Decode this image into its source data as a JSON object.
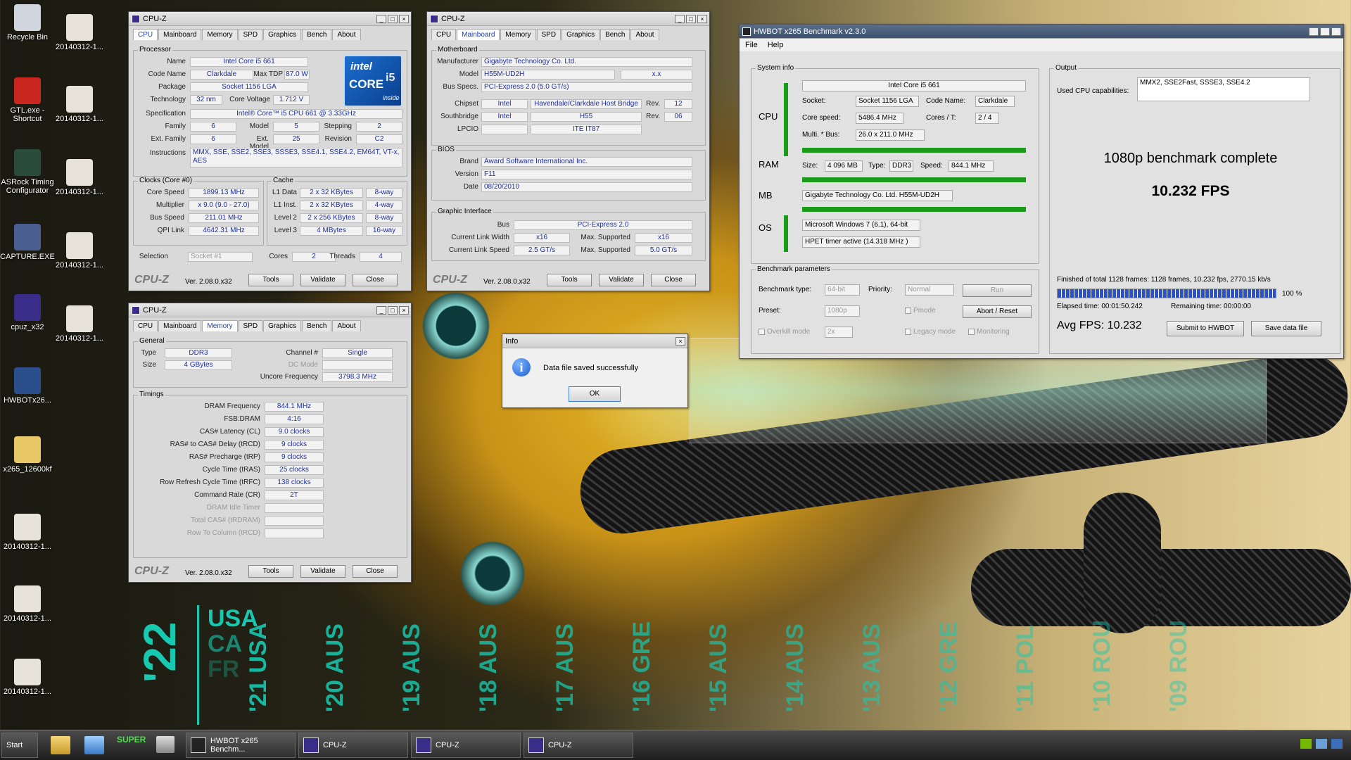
{
  "desktop": {
    "icons": [
      "Recycle Bin",
      "20140312-1...",
      "GTL.exe - Shortcut",
      "20140312-1...",
      "ASRock Timing Configurator",
      "20140312-1...",
      "CAPTURE.EXE",
      "20140312-1...",
      "cpuz_x32",
      "20140312-1...",
      "HWBOTx26...",
      "x265_12600kf",
      "20140312-1...",
      "20140312-1...",
      "20140312-1..."
    ],
    "wallpaper_text": {
      "year": "'22",
      "countries": [
        "USA",
        "CA",
        "FR"
      ],
      "timeline": [
        "'21 USA",
        "'20 AUS",
        "'19 AUS",
        "'18 AUS",
        "'17 AUS",
        "'16 GRE",
        "'15 AUS",
        "'14 AUS",
        "'13 AUS",
        "'12 GRE",
        "'11 POL",
        "'10 ROU",
        "'09 ROU"
      ]
    }
  },
  "cpuz_tabs": [
    "CPU",
    "Mainboard",
    "Memory",
    "SPD",
    "Graphics",
    "Bench",
    "About"
  ],
  "cpuz_common": {
    "title": "CPU-Z",
    "logo": "CPU-Z",
    "version": "Ver. 2.08.0.x32",
    "tools": "Tools",
    "validate": "Validate",
    "close": "Close"
  },
  "cpu_win": {
    "processor_title": "Processor",
    "labels": {
      "name": "Name",
      "codename": "Code Name",
      "maxtdp": "Max TDP",
      "package": "Package",
      "technology": "Technology",
      "corevoltage": "Core Voltage",
      "spec": "Specification",
      "family": "Family",
      "model": "Model",
      "stepping": "Stepping",
      "extfamily": "Ext. Family",
      "extmodel": "Ext. Model",
      "revision": "Revision",
      "instructions": "Instructions"
    },
    "name": "Intel Core i5 661",
    "codename": "Clarkdale",
    "maxtdp": "87.0 W",
    "package": "Socket 1156 LGA",
    "technology": "32 nm",
    "corevoltage": "1.712 V",
    "spec": "Intel® Core™ i5 CPU        661  @ 3.33GHz",
    "family": "6",
    "model": "5",
    "stepping": "2",
    "extfamily": "6",
    "extmodel": "25",
    "revision": "C2",
    "instructions": "MMX, SSE, SSE2, SSE3, SSSE3, SSE4.1, SSE4.2, EM64T, VT-x, AES",
    "intel_logo": {
      "brand": "intel",
      "line": "CORE",
      "model": "i5",
      "badge": "inside"
    },
    "clocks_title": "Clocks (Core #0)",
    "cache_title": "Cache",
    "clock_labels": [
      "Core Speed",
      "Multiplier",
      "Bus Speed",
      "QPI Link"
    ],
    "clocks": [
      "1899.13 MHz",
      "x 9.0 (9.0 - 27.0)",
      "211.01 MHz",
      "4642.31 MHz"
    ],
    "cache_labels": [
      "L1 Data",
      "L1 Inst.",
      "Level 2",
      "Level 3"
    ],
    "cache": [
      [
        "2 x 32 KBytes",
        "8-way"
      ],
      [
        "2 x 32 KBytes",
        "4-way"
      ],
      [
        "2 x 256 KBytes",
        "8-way"
      ],
      [
        "4 MBytes",
        "16-way"
      ]
    ],
    "selection_label": "Selection",
    "selection": "Socket #1",
    "cores_label": "Cores",
    "cores": "2",
    "threads_label": "Threads",
    "threads": "4"
  },
  "mb_win": {
    "motherboard_title": "Motherboard",
    "labels": {
      "manufacturer": "Manufacturer",
      "model": "Model",
      "busspecs": "Bus Specs.",
      "chipset": "Chipset",
      "southbridge": "Southbridge",
      "lpcio": "LPCIO",
      "rev": "Rev."
    },
    "manufacturer": "Gigabyte Technology Co. Ltd.",
    "model": "H55M-UD2H",
    "model_rev": "x.x",
    "busspecs": "PCI-Express 2.0 (5.0 GT/s)",
    "chipset": [
      "Intel",
      "Havendale/Clarkdale Host Bridge",
      "12"
    ],
    "southbridge": [
      "Intel",
      "H55",
      "06"
    ],
    "lpcio": [
      "",
      "ITE IT87"
    ],
    "bios_title": "BIOS",
    "bios_labels": [
      "Brand",
      "Version",
      "Date"
    ],
    "bios": [
      "Award Software International Inc.",
      "F11",
      "08/20/2010"
    ],
    "gi_title": "Graphic Interface",
    "gi_labels": {
      "bus": "Bus",
      "width": "Current Link Width",
      "maxw": "Max. Supported",
      "speed": "Current Link Speed",
      "maxs": "Max. Supported"
    },
    "gi": {
      "bus": "PCI-Express 2.0",
      "width": "x16",
      "maxw": "x16",
      "speed": "2.5 GT/s",
      "maxs": "5.0 GT/s"
    }
  },
  "mem_win": {
    "general_title": "General",
    "labels": {
      "type": "Type",
      "size": "Size",
      "channel": "Channel #",
      "dcmode": "DC Mode",
      "uncore": "Uncore Frequency"
    },
    "type": "DDR3",
    "size": "4 GBytes",
    "channel": "Single",
    "dcmode": "",
    "uncore": "3798.3 MHz",
    "timings_title": "Timings",
    "timing_labels": [
      "DRAM Frequency",
      "FSB:DRAM",
      "CAS# Latency (CL)",
      "RAS# to CAS# Delay (tRCD)",
      "RAS# Precharge (tRP)",
      "Cycle Time (tRAS)",
      "Row Refresh Cycle Time (tRFC)",
      "Command Rate (CR)",
      "DRAM Idle Timer",
      "Total CAS# (tRDRAM)",
      "Row To Column (tRCD)"
    ],
    "timings": [
      "844.1 MHz",
      "4:16",
      "9.0 clocks",
      "9 clocks",
      "9 clocks",
      "25 clocks",
      "138 clocks",
      "2T",
      "",
      "",
      ""
    ]
  },
  "info_dialog": {
    "title": "Info",
    "message": "Data file saved successfully",
    "ok": "OK"
  },
  "hwbot": {
    "title": "HWBOT x265 Benchmark v2.3.0",
    "menu": [
      "File",
      "Help"
    ],
    "sysinfo_title": "System info",
    "output_title": "Output",
    "cpu_label": "CPU",
    "cpu_name": "Intel Core i5 661",
    "socket_label": "Socket:",
    "socket": "Socket 1156 LGA",
    "codename_label": "Code Name:",
    "codename": "Clarkdale",
    "corespeed_label": "Core speed:",
    "corespeed": "5486.4 MHz",
    "corest_label": "Cores / T:",
    "corest": "2 / 4",
    "multi_label": "Multi. * Bus:",
    "multi": "26.0 x 211.0 MHz",
    "ram_label": "RAM",
    "size_label": "Size:",
    "size": "4 096 MB",
    "type_label": "Type:",
    "type": "DDR3",
    "speed_label": "Speed:",
    "speed": "844.1 MHz",
    "mb_label": "MB",
    "mb": "Gigabyte Technology Co. Ltd. H55M-UD2H",
    "os_label": "OS",
    "os": "Microsoft Windows 7 (6.1), 64-bit",
    "timer": "HPET timer active (14.318 MHz )",
    "capabilities_label": "Used CPU capabilities:",
    "capabilities": "MMX2, SSE2Fast, SSSE3, SSE4.2",
    "status": "1080p benchmark complete",
    "fps": "10.232 FPS",
    "params_title": "Benchmark parameters",
    "benchtype_label": "Benchmark type:",
    "benchtype": "64-bit",
    "priority_label": "Priority:",
    "priority": "Normal",
    "run": "Run",
    "preset_label": "Preset:",
    "preset": "1080p",
    "pmode": "Pmode",
    "abort": "Abort / Reset",
    "overkill": "Overkill mode",
    "overkill_val": "2x",
    "legacy": "Legacy mode",
    "monitoring": "Monitoring",
    "finished": "Finished of total 1128 frames: 1128 frames, 10.232 fps,  2770.15 kb/s",
    "progress": 1.0,
    "progress_text": "100 %",
    "elapsed": "Elapsed time: 00:01:50.242",
    "remaining": "Remaining time: 00:00:00",
    "avg": "Avg FPS: 10.232",
    "submit": "Submit to HWBOT",
    "save": "Save data file"
  },
  "taskbar": {
    "start": "Start",
    "quick": "SUPER",
    "buttons": [
      "HWBOT x265 Benchm...",
      "CPU-Z",
      "CPU-Z",
      "CPU-Z"
    ]
  },
  "colors": {
    "accent_blue": "#1d2fa3",
    "green": "#1a9c1a",
    "teal": "#16c9b0"
  }
}
